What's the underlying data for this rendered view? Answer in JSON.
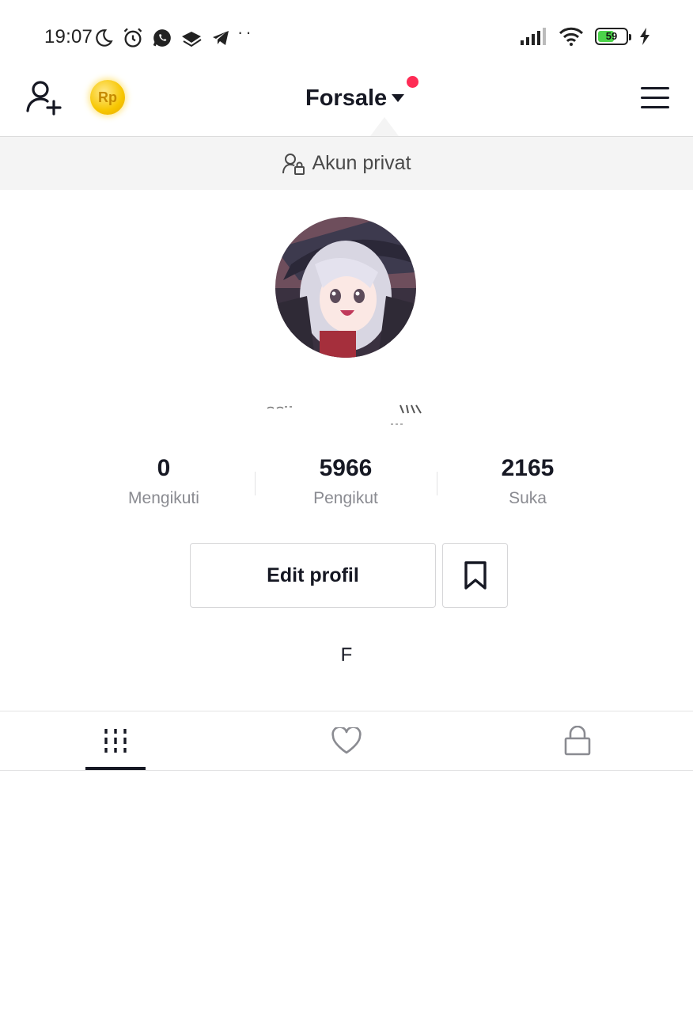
{
  "status_bar": {
    "time": "19:07",
    "battery_level": "59",
    "battery_fraction": 0.59,
    "icons_left": [
      "moon-icon",
      "alarm-icon",
      "whatsapp-icon",
      "graduation-cap-icon",
      "telegram-icon"
    ],
    "overflow_dots": "··",
    "icons_right": [
      "signal-icon",
      "wifi-icon",
      "battery-icon",
      "charging-icon"
    ]
  },
  "header": {
    "account_name": "Forsale",
    "coin_label": "Rp",
    "has_notification": true,
    "icons": [
      "add-user-icon",
      "coin-icon",
      "dropdown-caret-icon",
      "hamburger-menu-icon"
    ]
  },
  "private_banner": {
    "label": "Akun privat",
    "icon": "user-lock-icon"
  },
  "stats": [
    {
      "value": "0",
      "label": "Mengikuti"
    },
    {
      "value": "5966",
      "label": "Pengikut"
    },
    {
      "value": "2165",
      "label": "Suka"
    }
  ],
  "actions": {
    "edit_profile_label": "Edit profil",
    "bookmark_icon": "bookmark-icon"
  },
  "bio": "F",
  "tabs": [
    {
      "icon": "grid-videos-icon",
      "active": true
    },
    {
      "icon": "heart-icon",
      "active": false
    },
    {
      "icon": "lock-icon",
      "active": false
    }
  ],
  "colors": {
    "text_primary": "#161823",
    "text_secondary": "#8a8b91",
    "notification": "#fe2c55",
    "coin": "#f7c600",
    "banner_bg": "#f4f4f4",
    "battery_fill": "#4cd44a"
  }
}
